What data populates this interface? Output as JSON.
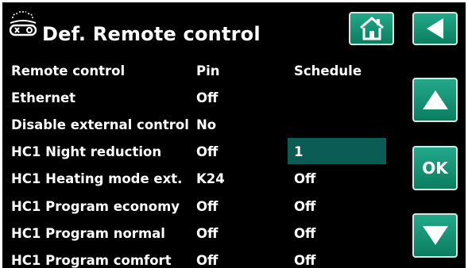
{
  "header": {
    "title": "Def. Remote control",
    "title_icon": "remote-control-icon"
  },
  "nav": {
    "home_icon": "home-icon",
    "back_icon": "back-arrow-icon",
    "up_icon": "up-arrow-icon",
    "ok_label": "OK",
    "down_icon": "down-arrow-icon"
  },
  "columns": {
    "name": "Remote control",
    "pin": "Pin",
    "schedule": "Schedule"
  },
  "rows": [
    {
      "name": "Ethernet",
      "pin": "Off",
      "schedule": ""
    },
    {
      "name": "Disable external control",
      "pin": "No",
      "schedule": ""
    },
    {
      "name": "HC1 Night reduction",
      "pin": "Off",
      "schedule": "1"
    },
    {
      "name": "HC1 Heating mode ext.",
      "pin": "K24",
      "schedule": "Off"
    },
    {
      "name": "HC1 Program economy",
      "pin": "Off",
      "schedule": "Off"
    },
    {
      "name": "HC1 Program normal",
      "pin": "Off",
      "schedule": "Off"
    },
    {
      "name": "HC1 Program comfort",
      "pin": "Off",
      "schedule": "Off"
    }
  ],
  "colors": {
    "background": "#000000",
    "button": "#15957a",
    "selected": "#0c5c56",
    "text": "#ffffff"
  }
}
